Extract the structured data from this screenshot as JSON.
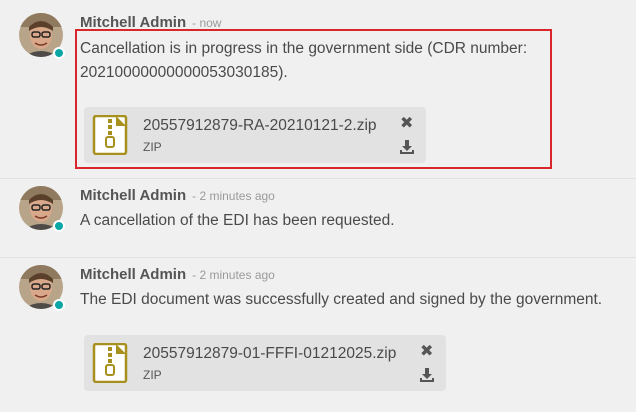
{
  "messages": [
    {
      "author": "Mitchell Admin",
      "time": "- now",
      "body": "Cancellation is in progress in the government side (CDR number: 20210000000000053030185).",
      "attachment": {
        "name": "20557912879-RA-20210121-2.zip",
        "type": "ZIP"
      }
    },
    {
      "author": "Mitchell Admin",
      "time": "- 2 minutes ago",
      "body": "A cancellation of the EDI has been requested."
    },
    {
      "author": "Mitchell Admin",
      "time": "- 2 minutes ago",
      "body": "The EDI document was successfully created and signed by the government.",
      "attachment": {
        "name": "20557912879-01-FFFI-01212025.zip",
        "type": "ZIP"
      }
    }
  ],
  "icons": {
    "close": "close-icon",
    "download": "download-icon",
    "zip": "zip-file-icon"
  },
  "colors": {
    "highlight_border": "#d9252c",
    "online_status": "#0aa5a5",
    "zip_icon": "#a8901e"
  }
}
